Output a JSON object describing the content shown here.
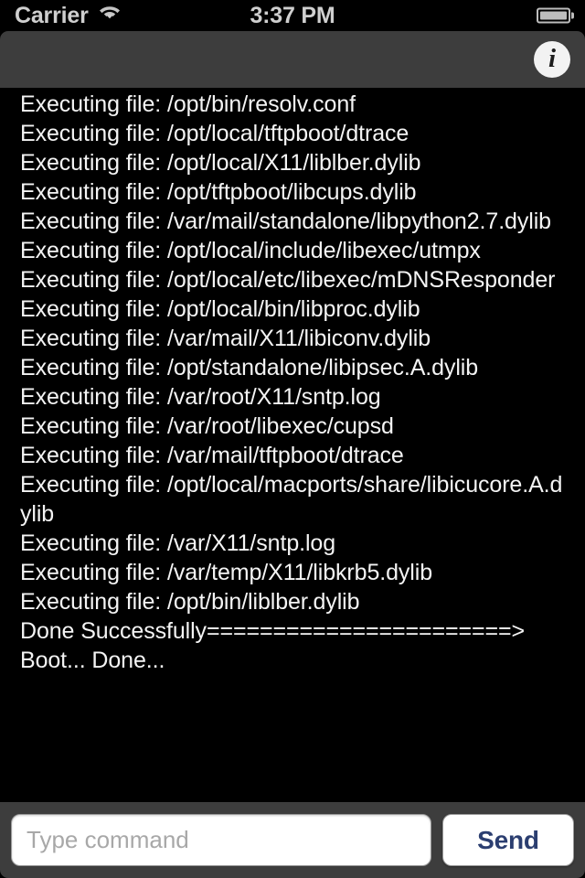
{
  "status_bar": {
    "carrier": "Carrier",
    "wifi_icon": "wifi-icon",
    "time": "3:37 PM",
    "battery_icon": "battery-icon"
  },
  "toolbar": {
    "info_button_label": "i",
    "info_icon": "info-circle-icon"
  },
  "console": {
    "lines": [
      "Executing file: /opt/bin/resolv.conf",
      "Executing file: /opt/local/tftpboot/dtrace",
      "Executing file: /opt/local/X11/liblber.dylib",
      "Executing file: /opt/tftpboot/libcups.dylib",
      "Executing file: /var/mail/standalone/libpython2.7.dylib",
      "Executing file: /opt/local/include/libexec/utmpx",
      "Executing file: /opt/local/etc/libexec/mDNSResponder",
      "Executing file: /opt/local/bin/libproc.dylib",
      "Executing file: /var/mail/X11/libiconv.dylib",
      "Executing file: /opt/standalone/libipsec.A.dylib",
      "Executing file: /var/root/X11/sntp.log",
      "Executing file: /var/root/libexec/cupsd",
      "Executing file: /var/mail/tftpboot/dtrace",
      "Executing file: /opt/local/macports/share/libicucore.A.dylib",
      "Executing file: /var/X11/sntp.log",
      "Executing file: /var/temp/X11/libkrb5.dylib",
      "Executing file: /opt/bin/liblber.dylib",
      "Done Successfully=======================>",
      "Boot... Done..."
    ]
  },
  "input_bar": {
    "command_value": "",
    "command_placeholder": "Type command",
    "send_label": "Send"
  },
  "colors": {
    "console_background": "#000000",
    "console_text": "#f4f4f4",
    "toolbar_background": "#3d3d3d",
    "status_bar_background": "#000000",
    "status_bar_text": "#cfcfcf",
    "send_button_text": "#2b3e70"
  }
}
